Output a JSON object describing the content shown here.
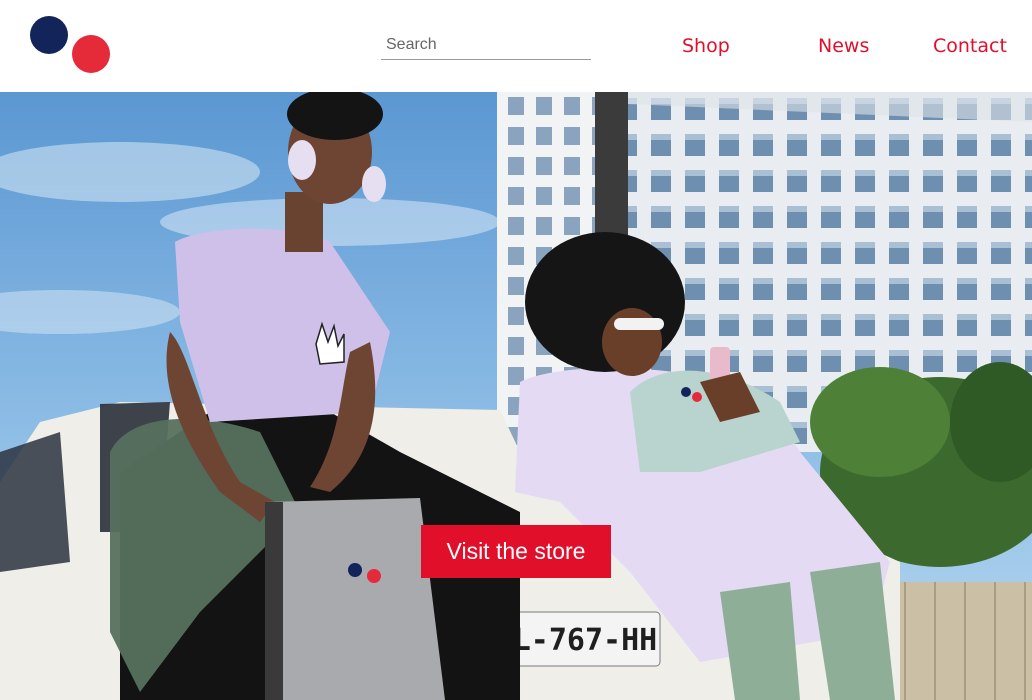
{
  "header": {
    "logo": {
      "icon": "two-dots-logo-icon",
      "colors": [
        "#13245a",
        "#e52a3a"
      ]
    },
    "search": {
      "placeholder": "Search",
      "value": ""
    },
    "nav": [
      {
        "label": "Shop"
      },
      {
        "label": "News"
      },
      {
        "label": "Contact"
      }
    ],
    "nav_color": "#e20f2b"
  },
  "hero": {
    "plate_text": "L-767-HH",
    "cta_label": "Visit the store",
    "cta_color": "#e20f2b"
  }
}
